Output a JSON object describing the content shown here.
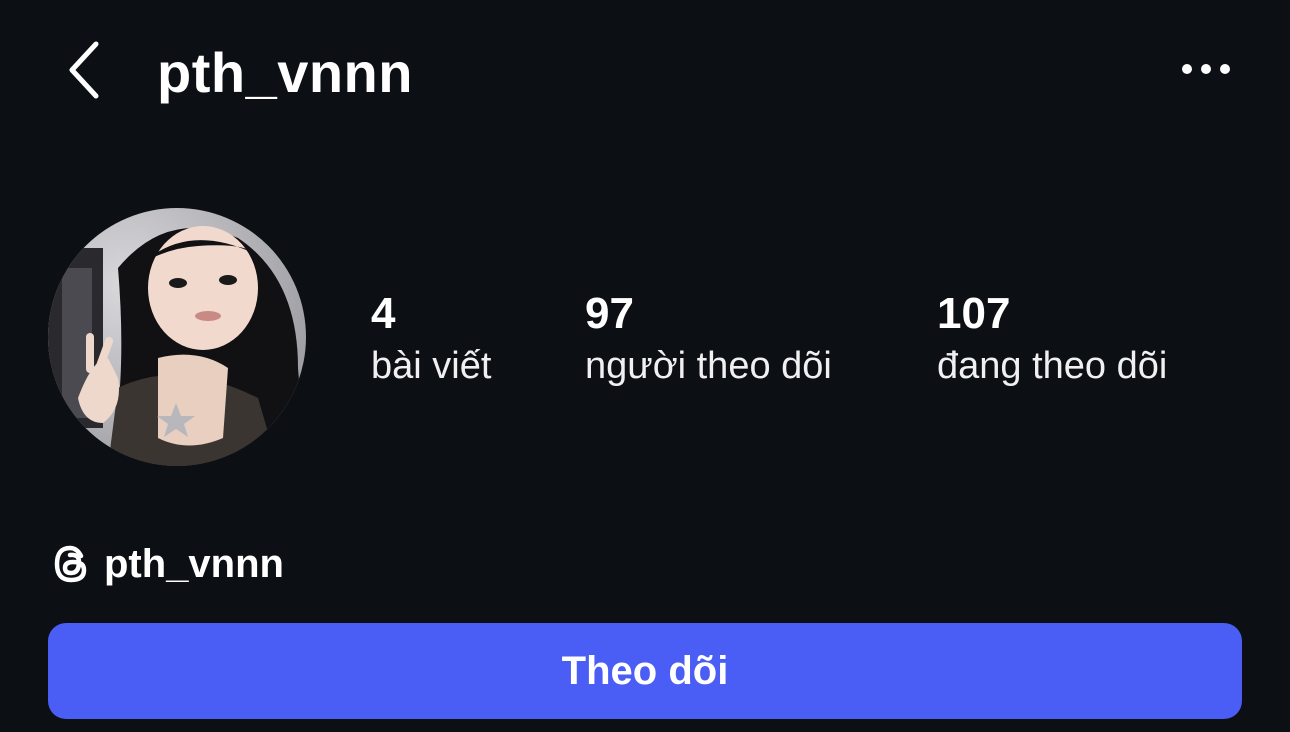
{
  "header": {
    "back_icon": "chevron-left-icon",
    "username": "pth_vnnn",
    "more_icon": "more-horizontal-icon"
  },
  "profile": {
    "avatar_alt": "profile photo",
    "stats": [
      {
        "value": "4",
        "label": "bài viết"
      },
      {
        "value": "97",
        "label": "người theo dõi"
      },
      {
        "value": "107",
        "label": "đang theo dõi"
      }
    ]
  },
  "threads": {
    "icon": "threads-icon",
    "handle": "pth_vnnn"
  },
  "actions": {
    "follow_label": "Theo dõi"
  },
  "colors": {
    "background": "#0c0f14",
    "text": "#ffffff",
    "button_accent": "#4a5df5"
  }
}
